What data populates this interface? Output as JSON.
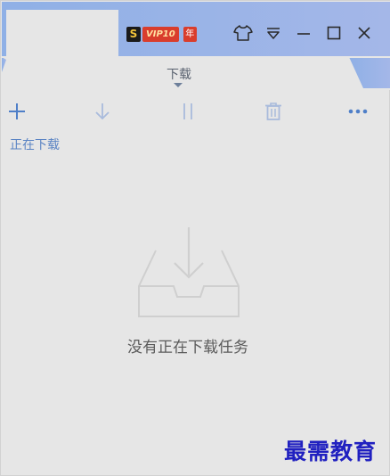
{
  "window": {
    "vip_badge": {
      "s_mark": "S",
      "level": "VIP10",
      "year": "年"
    },
    "controls": [
      "skin-icon",
      "menu-icon",
      "minimize-icon",
      "maximize-icon",
      "close-icon"
    ]
  },
  "tabs": {
    "active_label": "下载"
  },
  "toolbar": {
    "buttons": [
      "add-icon",
      "download-icon",
      "pause-icon",
      "delete-icon",
      "more-icon"
    ]
  },
  "section": {
    "title": "正在下载"
  },
  "empty_state": {
    "message": "没有正在下载任务"
  },
  "watermark": "最需教育",
  "colors": {
    "accent": "#5b84c4",
    "header_blue": "#9db1e4",
    "icon_gray": "#8fa7cf"
  }
}
